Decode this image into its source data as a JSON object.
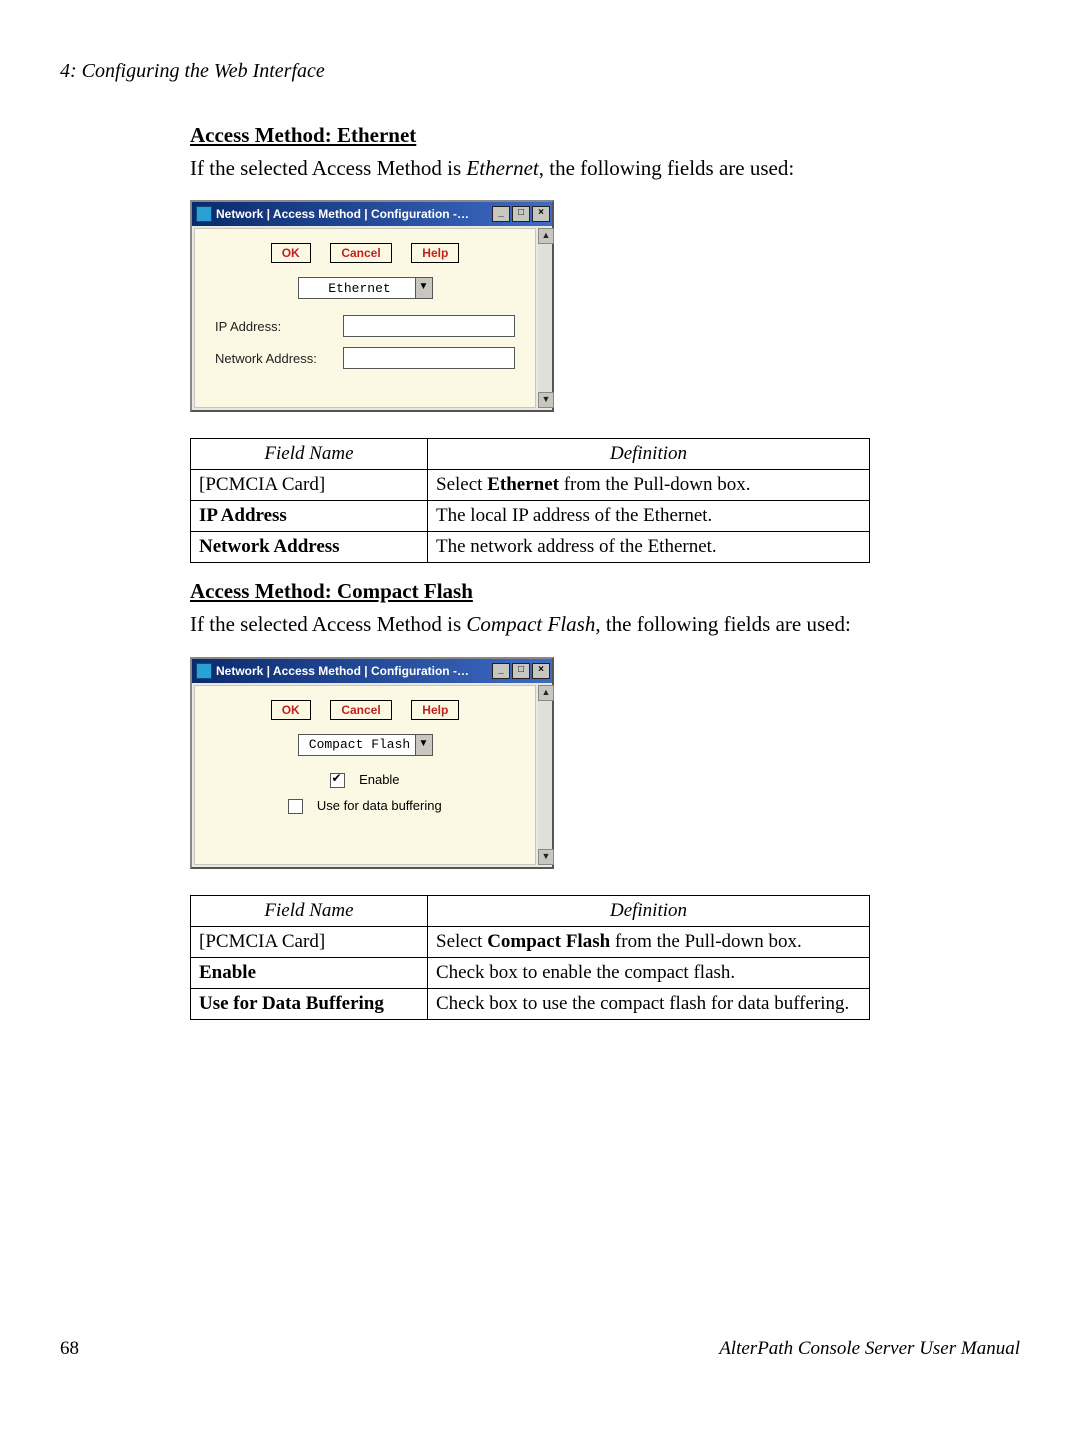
{
  "runningHead": "4: Configuring the Web Interface",
  "pageNumber": "68",
  "manualTitle": "AlterPath Console Server User Manual",
  "eth": {
    "heading": "Access Method: Ethernet",
    "intro_pre": "If the selected Access Method is ",
    "intro_em": "Ethernet",
    "intro_post": ", the following fields are used:",
    "dialog": {
      "title": "Network | Access Method | Configuration -…",
      "btn_ok": "OK",
      "btn_cancel": "Cancel",
      "btn_help": "Help",
      "select_value": "Ethernet",
      "lbl_ip": "IP Address:",
      "lbl_net": "Network Address:"
    },
    "table": {
      "h1": "Field Name",
      "h2": "Definition",
      "rows": [
        {
          "f": "[PCMCIA Card]",
          "d_pre": "Select ",
          "d_b": "Ethernet",
          "d_post": " from the Pull-down box.",
          "fbold": false
        },
        {
          "f": "IP Address",
          "d_pre": "The local IP address of the Ethernet.",
          "d_b": "",
          "d_post": "",
          "fbold": true
        },
        {
          "f": "Network Address",
          "d_pre": "The network address of the Ethernet.",
          "d_b": "",
          "d_post": "",
          "fbold": true
        }
      ]
    }
  },
  "cf": {
    "heading": "Access Method: Compact Flash",
    "intro_pre": "If the selected Access Method is ",
    "intro_em": "Compact Flash",
    "intro_post": ", the following fields are used:",
    "dialog": {
      "title": "Network | Access Method | Configuration -…",
      "btn_ok": "OK",
      "btn_cancel": "Cancel",
      "btn_help": "Help",
      "select_value": "Compact Flash",
      "chk_enable": "Enable",
      "chk_buffer": "Use for data buffering"
    },
    "table": {
      "h1": "Field Name",
      "h2": "Definition",
      "rows": [
        {
          "f": "[PCMCIA Card]",
          "d_pre": "Select ",
          "d_b": "Compact Flash",
          "d_post": " from the Pull-down box.",
          "fbold": false
        },
        {
          "f": "Enable",
          "d_pre": "Check box to enable the compact flash.",
          "d_b": "",
          "d_post": "",
          "fbold": true
        },
        {
          "f": "Use for Data Buffering",
          "d_pre": "Check box to use the compact flash for data buffering.",
          "d_b": "",
          "d_post": "",
          "fbold": true
        }
      ]
    }
  },
  "winBtns": {
    "min": "_",
    "max": "□",
    "close": "×"
  },
  "arrows": {
    "up": "▲",
    "down": "▼"
  }
}
